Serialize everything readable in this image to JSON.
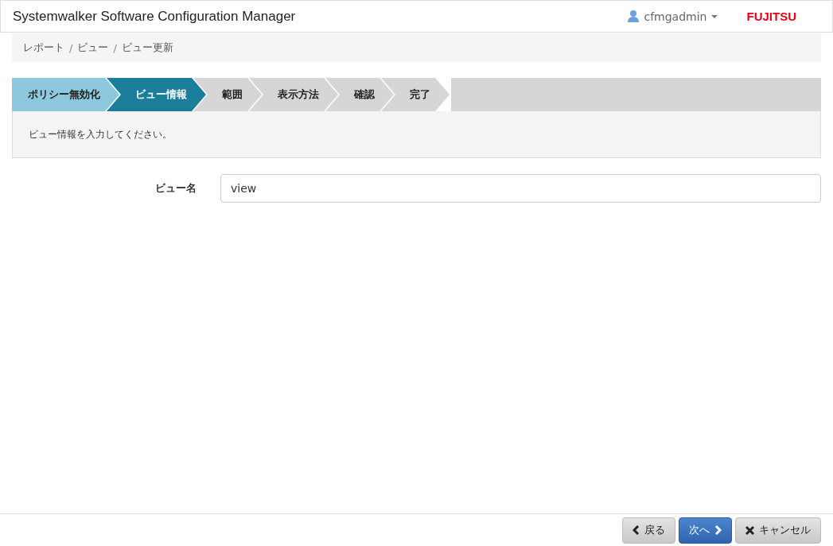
{
  "header": {
    "title": "Systemwalker Software Configuration Manager",
    "user": "cfmgadmin",
    "logo": "FUJITSU"
  },
  "breadcrumb": [
    {
      "text": "レポート",
      "kind": "link"
    },
    {
      "text": "/",
      "kind": "separator"
    },
    {
      "text": "ビュー",
      "kind": "link"
    },
    {
      "text": "/",
      "kind": "separator"
    },
    {
      "text": "ビュー更新",
      "kind": "current"
    }
  ],
  "steps": [
    {
      "label": "ポリシー無効化",
      "done": true,
      "selected": false
    },
    {
      "label": "ビュー情報",
      "done": false,
      "selected": true
    },
    {
      "label": "範囲",
      "done": false,
      "selected": false
    },
    {
      "label": "表示方法",
      "done": false,
      "selected": false
    },
    {
      "label": "確認",
      "done": false,
      "selected": false
    },
    {
      "label": "完了",
      "done": false,
      "selected": false
    }
  ],
  "message": "ビュー情報を入力してください。",
  "form": {
    "label": "ビュー名",
    "value": "view"
  },
  "buttons": [
    {
      "label": "戻る",
      "kind": "back"
    },
    {
      "label": "次へ",
      "kind": "next"
    },
    {
      "label": "キャンセル",
      "kind": "cancel"
    }
  ]
}
